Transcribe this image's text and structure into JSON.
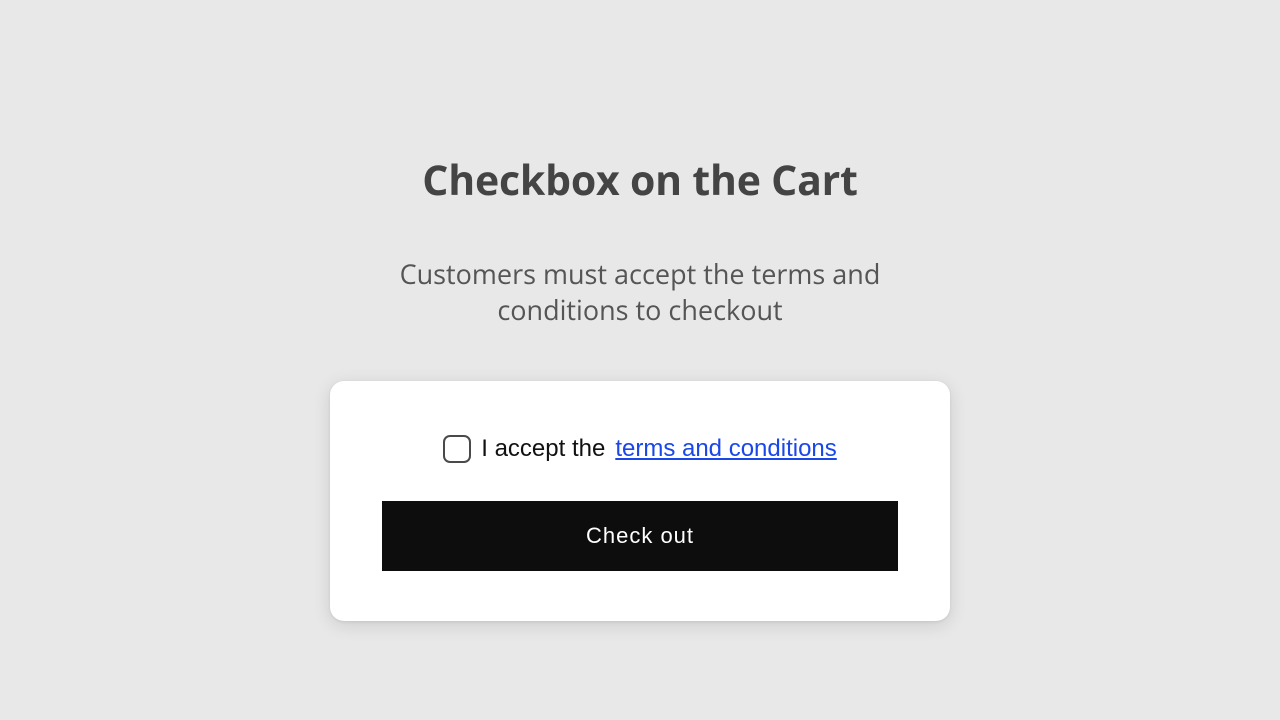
{
  "heading": "Checkbox on the Cart",
  "subheading": "Customers must accept the terms and conditions to checkout",
  "card": {
    "accept_prefix": "I accept the ",
    "terms_link_text": "terms and conditions",
    "checkout_button": "Check out"
  }
}
